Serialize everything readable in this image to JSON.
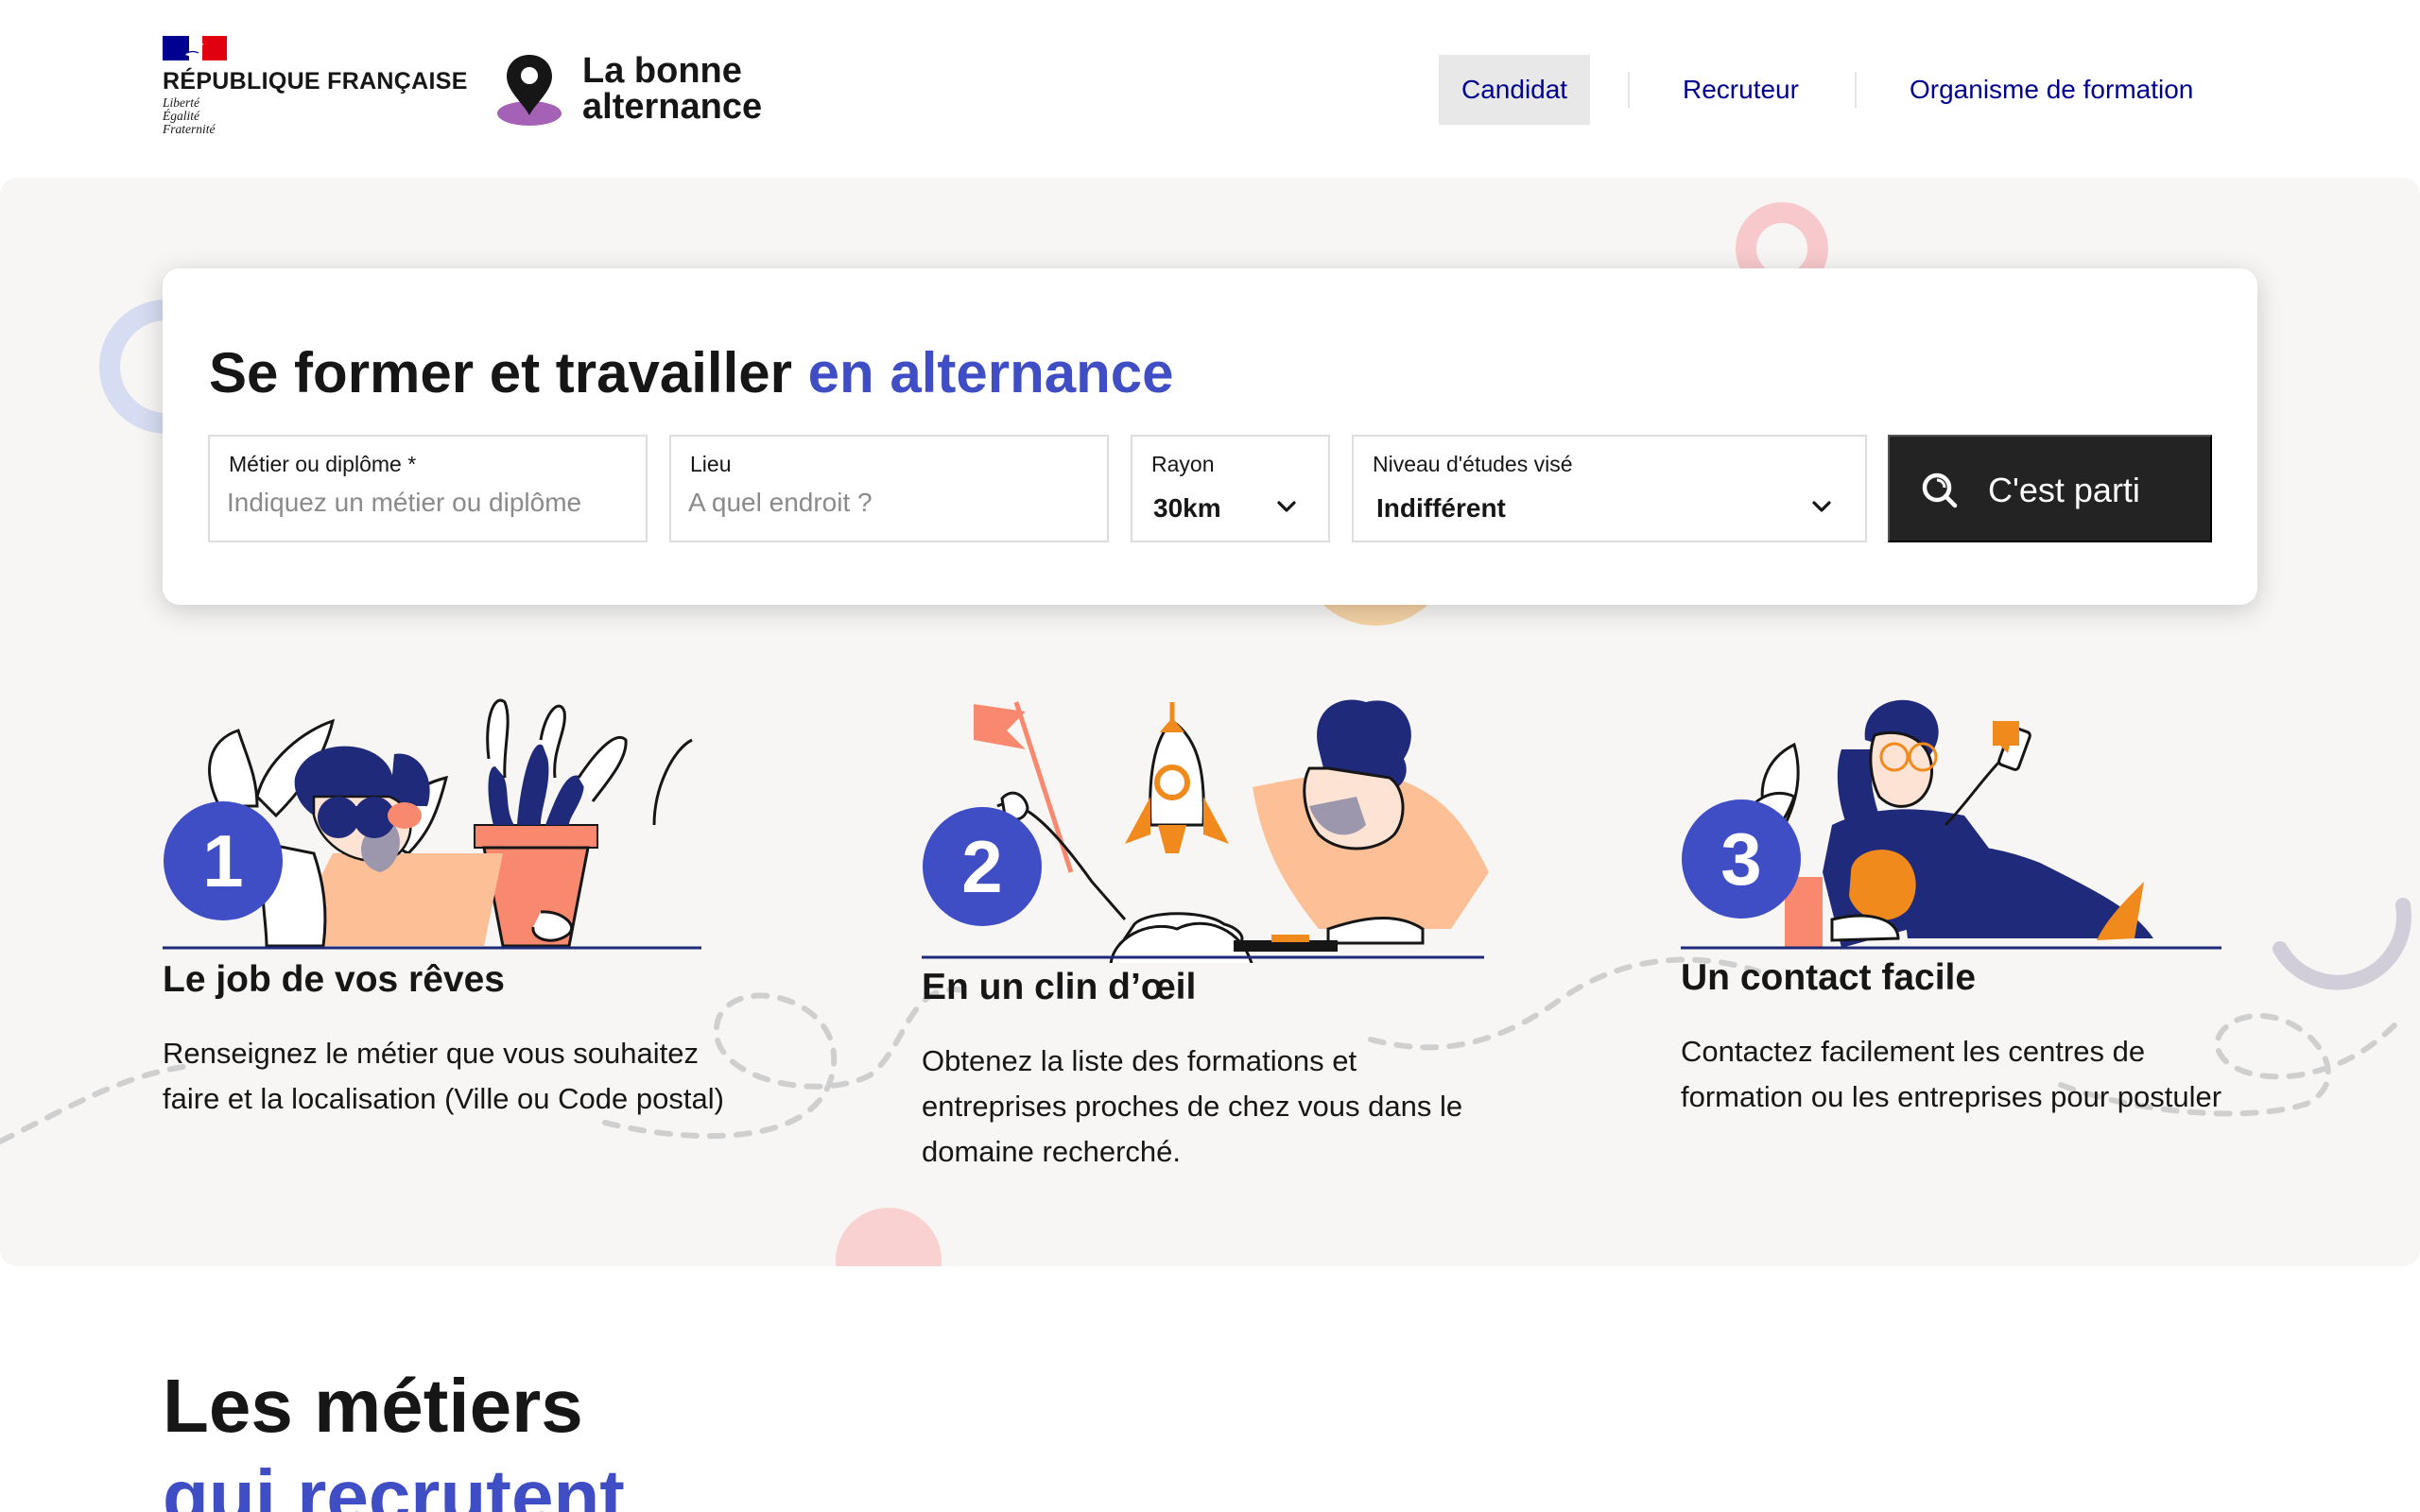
{
  "header": {
    "republique": {
      "name": "RÉPUBLIQUE FRANÇAISE",
      "motto": [
        "Liberté",
        "Égalité",
        "Fraternité"
      ]
    },
    "brand": {
      "line1": "La bonne",
      "line2": "alternance"
    },
    "nav": [
      {
        "label": "Candidat",
        "active": true
      },
      {
        "label": "Recruteur",
        "active": false
      },
      {
        "label": "Organisme de formation",
        "active": false
      }
    ]
  },
  "search": {
    "title": "Se former et travailler",
    "title_accent": "en alternance",
    "metier": {
      "label": "Métier ou diplôme *",
      "placeholder": "Indiquez un métier ou diplôme"
    },
    "lieu": {
      "label": "Lieu",
      "placeholder": "A quel endroit ?"
    },
    "rayon": {
      "label": "Rayon",
      "value": "30km"
    },
    "niveau": {
      "label": "Niveau d'études visé",
      "value": "Indifférent"
    },
    "submit": {
      "label": "C'est parti",
      "icon": "search-icon"
    }
  },
  "steps": [
    {
      "number": "1",
      "title": "Le job de vos rêves",
      "description": "Renseignez le métier que vous souhaitez faire et la localisation (Ville ou Code postal)"
    },
    {
      "number": "2",
      "title": "En un clin d’œil",
      "description": "Obtenez la liste des formations et entreprises proches de chez vous dans le domaine recherché."
    },
    {
      "number": "3",
      "title": "Un contact facile",
      "description": "Contactez facilement les centres de formation ou les entreprises pour postuler"
    }
  ],
  "metiers": {
    "title": "Les métiers",
    "subtitle": "qui recrutent"
  },
  "colors": {
    "accent_blue": "#3f4ec5",
    "nav_blue": "#000091",
    "button_dark": "#232323",
    "hero_bg": "#f7f6f4",
    "step_badge": "#3f4ec5"
  }
}
